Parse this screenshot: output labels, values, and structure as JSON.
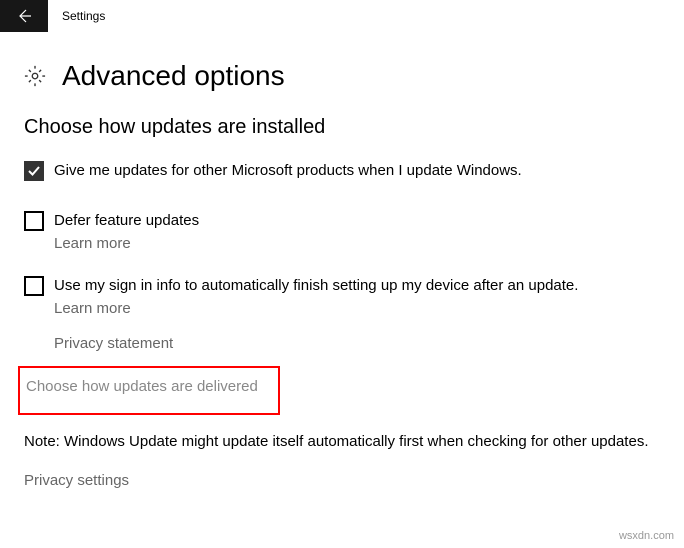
{
  "header": {
    "title": "Settings"
  },
  "page": {
    "title": "Advanced options"
  },
  "section": {
    "heading": "Choose how updates are installed"
  },
  "options": {
    "msProducts": {
      "label": "Give me updates for other Microsoft products when I update Windows.",
      "checked": true
    },
    "defer": {
      "label": "Defer feature updates",
      "learnMore": "Learn more",
      "checked": false
    },
    "signIn": {
      "label": "Use my sign in info to automatically finish setting up my device after an update.",
      "learnMore": "Learn more",
      "checked": false
    }
  },
  "links": {
    "privacyStatement": "Privacy statement",
    "deliveryOptimization": "Choose how updates are delivered",
    "privacySettings": "Privacy settings"
  },
  "note": "Note: Windows Update might update itself automatically first when checking for other updates.",
  "watermark": "wsxdn.com"
}
